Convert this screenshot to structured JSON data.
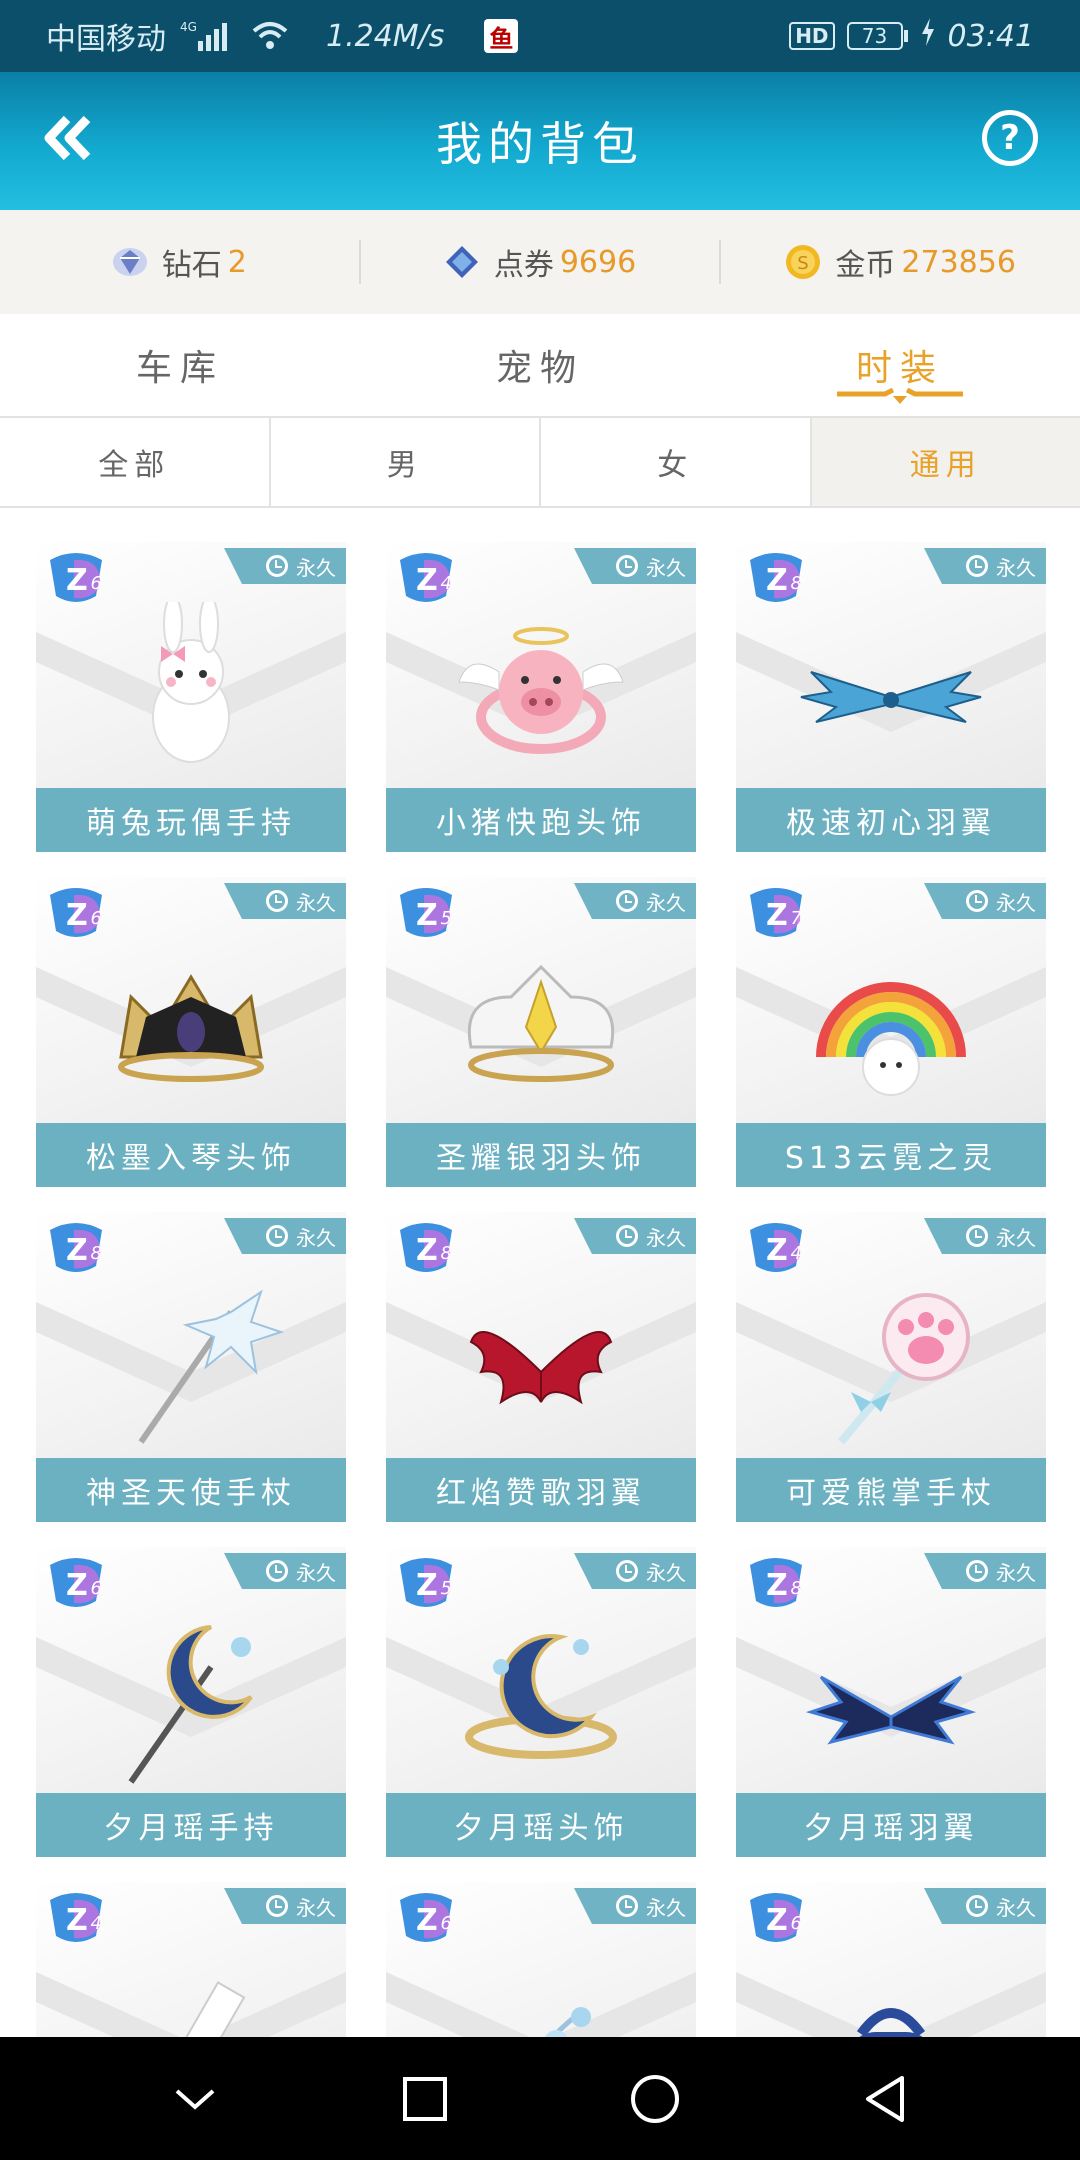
{
  "status_bar": {
    "carrier": "中国移动",
    "network": "4G",
    "speed": "1.24M/s",
    "app_icon_text": "鱼",
    "hd": "HD",
    "battery": "73",
    "time": "03:41"
  },
  "header": {
    "title": "我的背包",
    "back_icon": "double-chevron-left-icon",
    "help_label": "?"
  },
  "currency": [
    {
      "label": "钻石",
      "value": "2",
      "icon": "diamond-icon"
    },
    {
      "label": "点券",
      "value": "9696",
      "icon": "ticket-gem-icon"
    },
    {
      "label": "金币",
      "value": "273856",
      "icon": "gold-coin-icon"
    }
  ],
  "tabs": [
    {
      "label": "车库",
      "active": false
    },
    {
      "label": "宠物",
      "active": false
    },
    {
      "label": "时装",
      "active": true
    }
  ],
  "subtabs": [
    {
      "label": "全部",
      "active": false
    },
    {
      "label": "男",
      "active": false
    },
    {
      "label": "女",
      "active": false
    },
    {
      "label": "通用",
      "active": true
    }
  ],
  "items": [
    {
      "name": "萌兔玩偶手持",
      "badge": "永久",
      "level": "6",
      "icon": "bunny-doll-icon"
    },
    {
      "name": "小猪快跑头饰",
      "badge": "永久",
      "level": "4",
      "icon": "angel-pig-icon"
    },
    {
      "name": "极速初心羽翼",
      "badge": "永久",
      "level": "8",
      "icon": "blue-wings-icon"
    },
    {
      "name": "松墨入琴头饰",
      "badge": "永久",
      "level": "6",
      "icon": "dark-crown-icon"
    },
    {
      "name": "圣耀银羽头饰",
      "badge": "永久",
      "level": "5",
      "icon": "silver-crown-icon"
    },
    {
      "name": "S13云霓之灵",
      "badge": "永久",
      "level": "7",
      "icon": "rainbow-cloud-icon"
    },
    {
      "name": "神圣天使手杖",
      "badge": "永久",
      "level": "8",
      "icon": "angel-staff-icon"
    },
    {
      "name": "红焰赞歌羽翼",
      "badge": "永久",
      "level": "8",
      "icon": "red-wings-icon"
    },
    {
      "name": "可爱熊掌手杖",
      "badge": "永久",
      "level": "4",
      "icon": "paw-wand-icon"
    },
    {
      "name": "夕月瑶手持",
      "badge": "永久",
      "level": "6",
      "icon": "moon-scepter-icon"
    },
    {
      "name": "夕月瑶头饰",
      "badge": "永久",
      "level": "5",
      "icon": "moon-crown-icon"
    },
    {
      "name": "夕月瑶羽翼",
      "badge": "永久",
      "level": "8",
      "icon": "dark-blue-wings-icon"
    },
    {
      "name": "",
      "badge": "永久",
      "level": "4",
      "icon": "red-item-icon"
    },
    {
      "name": "",
      "badge": "永久",
      "level": "6",
      "icon": "flower-item-icon"
    },
    {
      "name": "",
      "badge": "永久",
      "level": "6",
      "icon": "backpack-icon"
    }
  ],
  "colors": {
    "accent": "#e8a22a",
    "header": "#13a9cf",
    "card_label": "#6cb1c2"
  },
  "navbar": [
    "chevron-down-icon",
    "square-icon",
    "circle-icon",
    "triangle-back-icon"
  ]
}
